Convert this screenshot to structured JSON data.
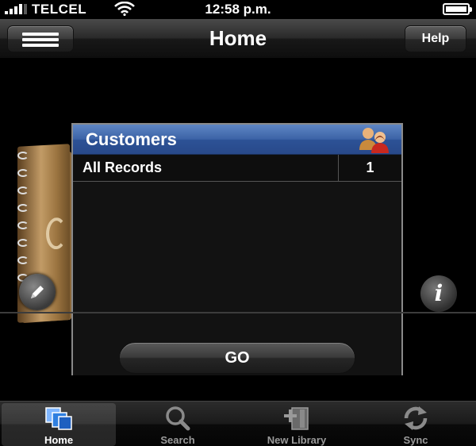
{
  "status_bar": {
    "carrier": "TELCEL",
    "time": "12:58 p.m."
  },
  "nav_bar": {
    "title": "Home",
    "help_label": "Help"
  },
  "library": {
    "name": "Customers",
    "records": [
      {
        "label": "All Records",
        "count": "1"
      }
    ]
  },
  "info_label": "i",
  "go_label": "GO",
  "tab_bar": {
    "tabs": [
      {
        "label": "Home",
        "icon": "home-icon",
        "active": true
      },
      {
        "label": "Search",
        "icon": "search-icon",
        "active": false
      },
      {
        "label": "New Library",
        "icon": "new-library-icon",
        "active": false
      },
      {
        "label": "Sync",
        "icon": "sync-icon",
        "active": false
      }
    ]
  },
  "colors": {
    "header_blue": "#3b62a6",
    "background": "#000000",
    "inactive_tab_label": "#9a9a9a"
  }
}
